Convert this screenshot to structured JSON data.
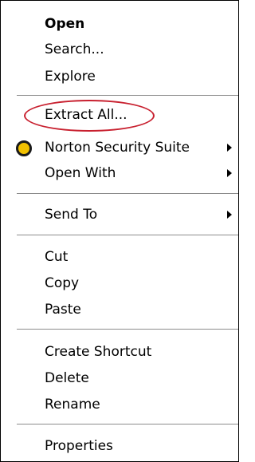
{
  "context_menu": {
    "items": [
      {
        "label": "Open",
        "default": true
      },
      {
        "label": "Search..."
      },
      {
        "label": "Explore"
      },
      {
        "label": "Extract All..."
      },
      {
        "label": "Norton Security Suite",
        "icon": "norton-circle-icon",
        "submenu": true
      },
      {
        "label": "Open With",
        "submenu": true
      },
      {
        "label": "Send To",
        "submenu": true
      },
      {
        "label": "Cut"
      },
      {
        "label": "Copy"
      },
      {
        "label": "Paste"
      },
      {
        "label": "Create Shortcut"
      },
      {
        "label": "Delete"
      },
      {
        "label": "Rename"
      },
      {
        "label": "Properties"
      }
    ],
    "highlighted_item": "Extract All...",
    "colors": {
      "highlight_ring": "#c8202f",
      "norton_icon": "#f2c100",
      "separator": "#8c8c8c",
      "border": "#000000"
    }
  }
}
